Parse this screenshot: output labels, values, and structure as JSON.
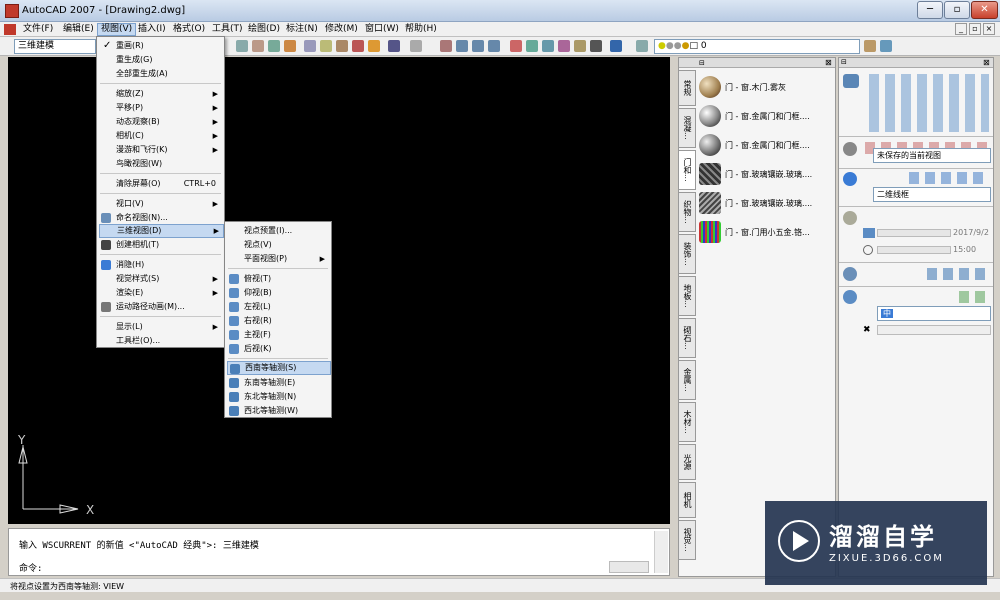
{
  "window": {
    "title": "AutoCAD 2007 - [Drawing2.dwg]"
  },
  "menubar": {
    "items": [
      "文件(F)",
      "编辑(E)",
      "视图(V)",
      "插入(I)",
      "格式(O)",
      "工具(T)",
      "绘图(D)",
      "标注(N)",
      "修改(M)",
      "窗口(W)",
      "帮助(H)"
    ]
  },
  "toolbar": {
    "workspace": "三维建模",
    "layer_value": "0"
  },
  "view_menu": {
    "items": [
      {
        "label": "重画(R)",
        "checked": true
      },
      {
        "label": "重生成(G)"
      },
      {
        "label": "全部重生成(A)"
      },
      {
        "label": "缩放(Z)",
        "sub": true
      },
      {
        "label": "平移(P)",
        "sub": true
      },
      {
        "label": "动态观察(B)",
        "sub": true
      },
      {
        "label": "相机(C)",
        "sub": true
      },
      {
        "label": "漫游和飞行(K)",
        "sub": true
      },
      {
        "label": "鸟瞰视图(W)"
      },
      {
        "label": "清除屏幕(O)",
        "accel": "CTRL+0"
      },
      {
        "label": "视口(V)",
        "sub": true
      },
      {
        "label": "命名视图(N)..."
      },
      {
        "label": "三维视图(D)",
        "sub": true
      },
      {
        "label": "创建相机(T)"
      },
      {
        "label": "消隐(H)"
      },
      {
        "label": "视觉样式(S)",
        "sub": true
      },
      {
        "label": "渲染(E)",
        "sub": true
      },
      {
        "label": "运动路径动画(M)..."
      },
      {
        "label": "显示(L)",
        "sub": true
      },
      {
        "label": "工具栏(O)..."
      }
    ]
  },
  "view3d_menu": {
    "items": [
      {
        "label": "视点预置(I)..."
      },
      {
        "label": "视点(V)"
      },
      {
        "label": "平面视图(P)",
        "sub": true
      },
      {
        "label": "俯视(T)"
      },
      {
        "label": "仰视(B)"
      },
      {
        "label": "左视(L)"
      },
      {
        "label": "右视(R)"
      },
      {
        "label": "主视(F)"
      },
      {
        "label": "后视(K)"
      },
      {
        "label": "西南等轴测(S)"
      },
      {
        "label": "东南等轴测(E)"
      },
      {
        "label": "东北等轴测(N)"
      },
      {
        "label": "西北等轴测(W)"
      }
    ]
  },
  "command": {
    "history": "输入 WSCURRENT 的新值 <\"AutoCAD 经典\">: 三维建模",
    "prompt": "命令:"
  },
  "status": {
    "text": "将视点设置为西南等轴测:  VIEW"
  },
  "materials": {
    "tabs": [
      "常规",
      "混凝...",
      "门和...",
      "织物...",
      "装饰...",
      "地板...",
      "砌石...",
      "金属...",
      "木材...",
      "光源",
      "相机",
      "视觉..."
    ],
    "items": [
      "门 - 窗.木门.雾灰",
      "门 - 窗.金属门和门框....",
      "门 - 窗.金属门和门框....",
      "门 - 窗.玻璃镶嵌.玻璃....",
      "门 - 窗.玻璃镶嵌.玻璃....",
      "门 - 窗.门用小五金.铬..."
    ]
  },
  "dashboard": {
    "view_combo": "未保存的当前视图",
    "visual_style": "二维线框",
    "date": "2017/9/2",
    "time": "15:00",
    "render_quality": "中"
  },
  "watermark": {
    "brand": "溜溜自学",
    "url": "ZIXUE.3D66.COM"
  },
  "axes": {
    "y": "Y",
    "x": "X"
  }
}
